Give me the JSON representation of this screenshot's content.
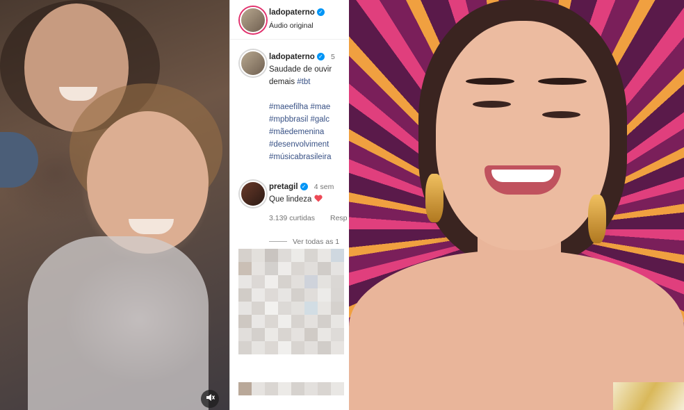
{
  "post": {
    "header_username": "ladopaterno",
    "audio_label": "Áudio original",
    "caption_username": "ladopaterno",
    "caption_time": "5",
    "caption_line1": "Saudade de ouvir",
    "caption_line2": "demais",
    "caption_tag": "#tbt",
    "hashtags": [
      "#maeefilha",
      "#mae",
      "#mpbbrasil",
      "#galc",
      "#mãedemenina",
      "#desenvolviment",
      "#músicabrasileira"
    ],
    "comment_username": "pretagil",
    "comment_time": "4 sem",
    "comment_text": "Que lindeza",
    "likes": "3.139 curtidas",
    "reply_label": "Resp",
    "view_all": "Ver todas as 1"
  },
  "colors": {
    "verified": "#0095f6",
    "heart": "#ed4956",
    "hashtag": "#385185"
  },
  "icons": [
    "verified-icon",
    "heart-icon",
    "volume-icon"
  ]
}
